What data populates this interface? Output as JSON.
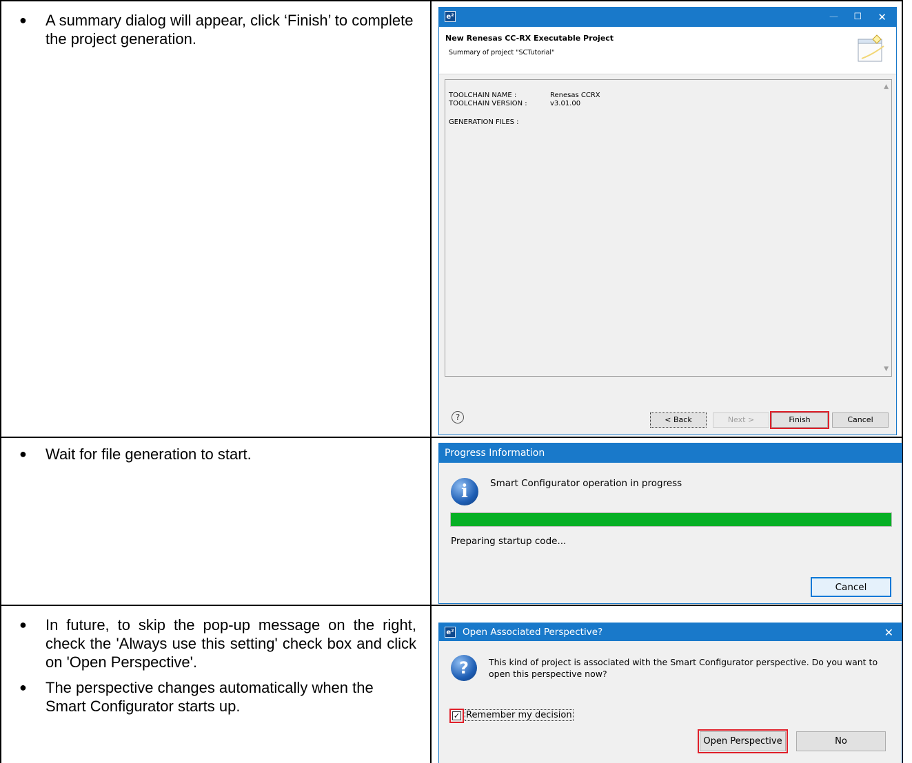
{
  "rows": [
    {
      "bullets": [
        "A summary dialog will appear, click ‘Finish’ to complete the project generation."
      ]
    },
    {
      "bullets": [
        "Wait for file generation to start."
      ]
    },
    {
      "bullets": [
        "In future, to skip the pop-up message on the right, check the 'Always use this setting' check box and click on 'Open Perspective'.",
        "The perspective changes automatically when the Smart Configurator starts up."
      ]
    }
  ],
  "dialog1": {
    "app_icon": "e²",
    "header_title": "New Renesas CC-RX Executable Project",
    "header_subtitle": "Summary of project \"SCTutorial\"",
    "summary": {
      "toolchain_name_label": "TOOLCHAIN NAME :",
      "toolchain_name_value": "Renesas CCRX",
      "toolchain_version_label": "TOOLCHAIN VERSION :",
      "toolchain_version_value": "v3.01.00",
      "generation_files_label": "GENERATION FILES :"
    },
    "buttons": {
      "back": "< Back",
      "next": "Next >",
      "finish": "Finish",
      "cancel": "Cancel"
    }
  },
  "dialog2": {
    "title": "Progress Information",
    "message": "Smart Configurator operation in progress",
    "task": "Preparing startup code...",
    "progress": 1.0,
    "cancel": "Cancel"
  },
  "dialog3": {
    "app_icon": "e²",
    "title": "Open Associated Perspective?",
    "message": "This kind of project is associated with the Smart Configurator perspective.  Do you want to open this perspective now?",
    "checkbox_label": "Remember my decision",
    "checked": true,
    "buttons": {
      "open": "Open Perspective",
      "no": "No"
    }
  },
  "colors": {
    "titlebar": "#1979ca",
    "highlight": "#e0202a",
    "progress": "#06b025"
  }
}
